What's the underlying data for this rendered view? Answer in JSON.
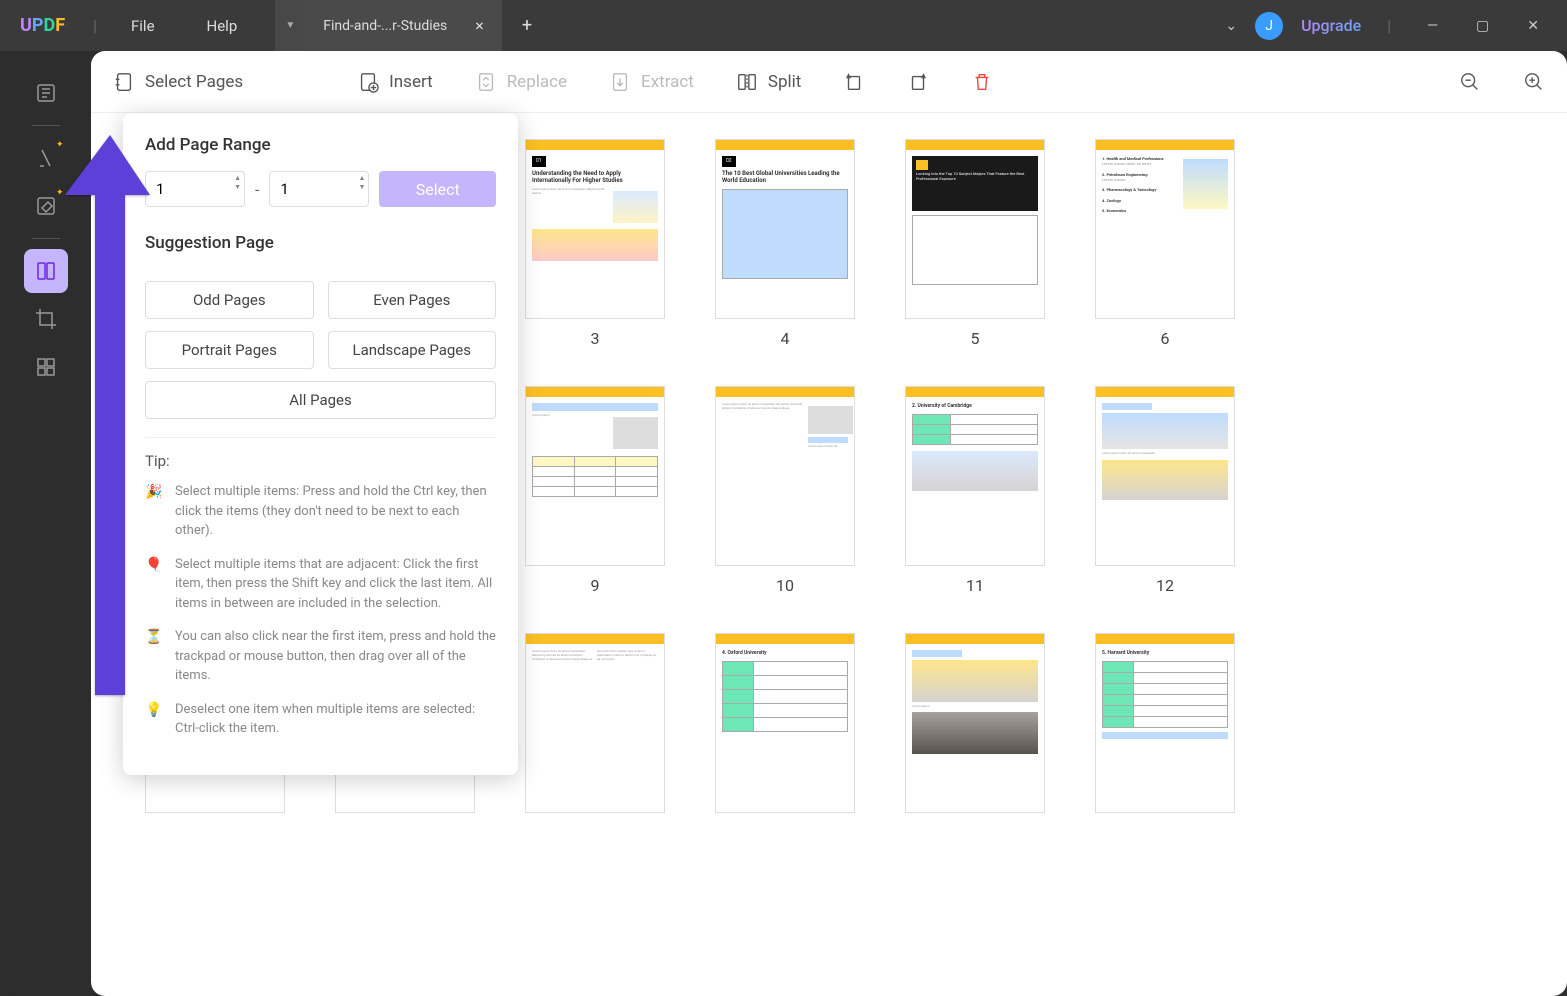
{
  "app": {
    "name": "UPDF"
  },
  "menu": {
    "file": "File",
    "help": "Help"
  },
  "tab": {
    "title": "Find-and-...r-Studies"
  },
  "header": {
    "upgrade": "Upgrade",
    "avatar_initial": "J"
  },
  "toolbar": {
    "select_pages": "Select Pages",
    "insert": "Insert",
    "replace": "Replace",
    "extract": "Extract",
    "split": "Split"
  },
  "popup": {
    "range_title": "Add Page Range",
    "from": "1",
    "to": "1",
    "select": "Select",
    "suggest_title": "Suggestion Page",
    "odd": "Odd Pages",
    "even": "Even Pages",
    "portrait": "Portrait Pages",
    "landscape": "Landscape Pages",
    "all": "All Pages",
    "tip_title": "Tip:",
    "tip1": "Select multiple items: Press and hold the Ctrl key, then click the items (they don't need to be next to each other).",
    "tip2": "Select multiple items that are adjacent: Click the first item, then press the Shift key and click the last item. All items in between are included in the selection.",
    "tip3": "You can also click near the first item, press and hold the trackpad or mouse button, then drag over all of the items.",
    "tip4": "Deselect one item when multiple items are selected: Ctrl-click the item."
  },
  "pages": {
    "p3": "3",
    "p4": "4",
    "p5": "5",
    "p6": "6",
    "p9": "9",
    "p10": "10",
    "p11": "11",
    "p12": "12"
  }
}
